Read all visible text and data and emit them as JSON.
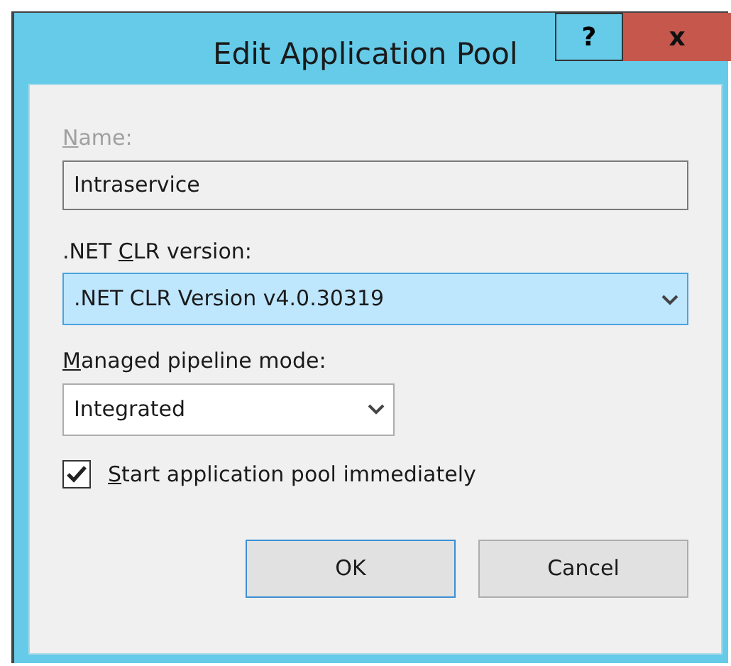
{
  "window": {
    "title": "Edit Application Pool",
    "help_button": "?",
    "close_button": "x"
  },
  "fields": [
    {
      "kind": "text",
      "label_key": "N",
      "label_after": "ame:",
      "label_disabled": true,
      "value": "Intraservice"
    },
    {
      "kind": "dropdown",
      "label_before": ".NET ",
      "label_key": "C",
      "label_after": "LR version:",
      "label_disabled": false,
      "value": ".NET CLR Version v4.0.30319",
      "focused": true
    },
    {
      "kind": "dropdown",
      "label_key": "M",
      "label_after": "anaged pipeline mode:",
      "label_disabled": false,
      "value": "Integrated",
      "focused": false
    }
  ],
  "checkbox": {
    "label_key": "S",
    "label_after": "tart application pool immediately",
    "checked": true
  },
  "buttons": [
    {
      "label": "OK",
      "default": true
    },
    {
      "label": "Cancel",
      "default": false
    }
  ]
}
